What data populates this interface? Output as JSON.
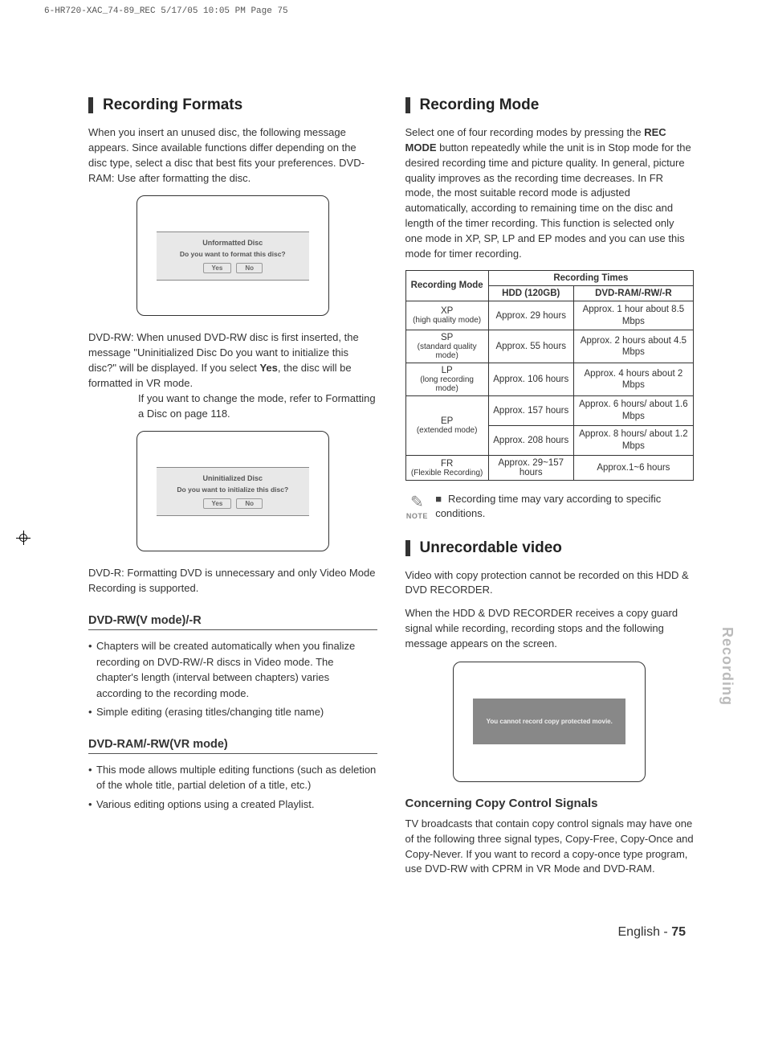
{
  "printHeader": "6-HR720-XAC_74-89_REC  5/17/05  10:05 PM  Page 75",
  "left": {
    "heading1": "Recording Formats",
    "intro": "When you insert an unused disc, the following message appears. Since available functions differ depending on the disc type, select a disc that best fits your preferences. DVD-RAM: Use after formatting the disc.",
    "osd1": {
      "title": "Unformatted Disc",
      "subtitle": "Do you want to format this disc?",
      "yes": "Yes",
      "no": "No"
    },
    "dvdrw_term": "DVD-RW:",
    "dvdrw_desc1": "When unused DVD-RW disc is first inserted, the message \"Uninitialized Disc Do you want to initialize this disc?\" will be displayed. If you select ",
    "dvdrw_yes": "Yes",
    "dvdrw_desc1b": ", the disc will be formatted in VR mode.",
    "dvdrw_desc2": "If you want to change the mode, refer to Formatting a Disc on page 118.",
    "osd2": {
      "title": "Uninitialized Disc",
      "subtitle": "Do you want to initialize this disc?",
      "yes": "Yes",
      "no": "No"
    },
    "dvdr_term": "DVD-R:",
    "dvdr_desc": "Formatting DVD is unnecessary and only Video Mode Recording is supported.",
    "sub1": "DVD-RW(V mode)/-R",
    "sub1_b1": "Chapters will be created automatically when you finalize recording on DVD-RW/-R discs in Video mode. The chapter's length (interval between chapters) varies according to the recording mode.",
    "sub1_b2": "Simple editing (erasing titles/changing title name)",
    "sub2": "DVD-RAM/-RW(VR mode)",
    "sub2_b1": "This mode allows multiple editing functions (such as deletion of the whole title, partial deletion of a title, etc.)",
    "sub2_b2": "Various editing options using a created Playlist."
  },
  "right": {
    "heading1": "Recording Mode",
    "intro1": "Select one of four recording modes by pressing the ",
    "intro_bold": "REC MODE",
    "intro2": " button repeatedly while the unit is in Stop mode for the desired recording time and picture quality. In general, picture quality improves as the recording time decreases. In FR mode, the most suitable record mode is adjusted automatically, according to remaining time on the disc and length of the timer recording. This function is selected only one mode in XP, SP, LP and EP modes and you can use this mode for timer recording.",
    "table": {
      "h_mode": "Recording Mode",
      "h_times": "Recording Times",
      "h_hdd": "HDD (120GB)",
      "h_dvd": "DVD-RAM/-RW/-R",
      "rows": [
        {
          "mode": "XP",
          "sub": "(high quality mode)",
          "hdd": "Approx. 29 hours",
          "dvd": "Approx. 1 hour about 8.5 Mbps"
        },
        {
          "mode": "SP",
          "sub": "(standard quality mode)",
          "hdd": "Approx. 55 hours",
          "dvd": "Approx. 2 hours about 4.5 Mbps"
        },
        {
          "mode": "LP",
          "sub": "(long recording mode)",
          "hdd": "Approx. 106 hours",
          "dvd": "Approx. 4 hours about 2 Mbps"
        }
      ],
      "ep": {
        "mode": "EP",
        "sub": "(extended mode)",
        "r1_hdd": "Approx. 157 hours",
        "r1_dvd": "Approx. 6 hours/ about 1.6 Mbps",
        "r2_hdd": "Approx. 208 hours",
        "r2_dvd": "Approx. 8 hours/ about 1.2 Mbps"
      },
      "fr": {
        "mode": "FR",
        "sub": "(Flexible Recording)",
        "hdd": "Approx. 29~157 hours",
        "dvd": "Approx.1~6 hours"
      }
    },
    "note_label": "NOTE",
    "note_text": "Recording time may vary according to specific conditions.",
    "heading2": "Unrecordable video",
    "unrec_p1": "Video with copy protection cannot be recorded on this HDD & DVD RECORDER.",
    "unrec_p2": "When the HDD & DVD RECORDER receives a copy guard signal while recording, recording stops and the following message appears on the screen.",
    "osd3": "You cannot record copy protected movie.",
    "sub3": "Concerning Copy Control Signals",
    "sub3_p": "TV broadcasts that contain copy control signals may have one of the following three signal types, Copy-Free, Copy-Once and Copy-Never. If you want to record a copy-once type program, use DVD-RW with CPRM in VR Mode and DVD-RAM."
  },
  "sideTab": "Recording",
  "footer": {
    "lang": "English",
    "sep": " - ",
    "page": "75"
  }
}
